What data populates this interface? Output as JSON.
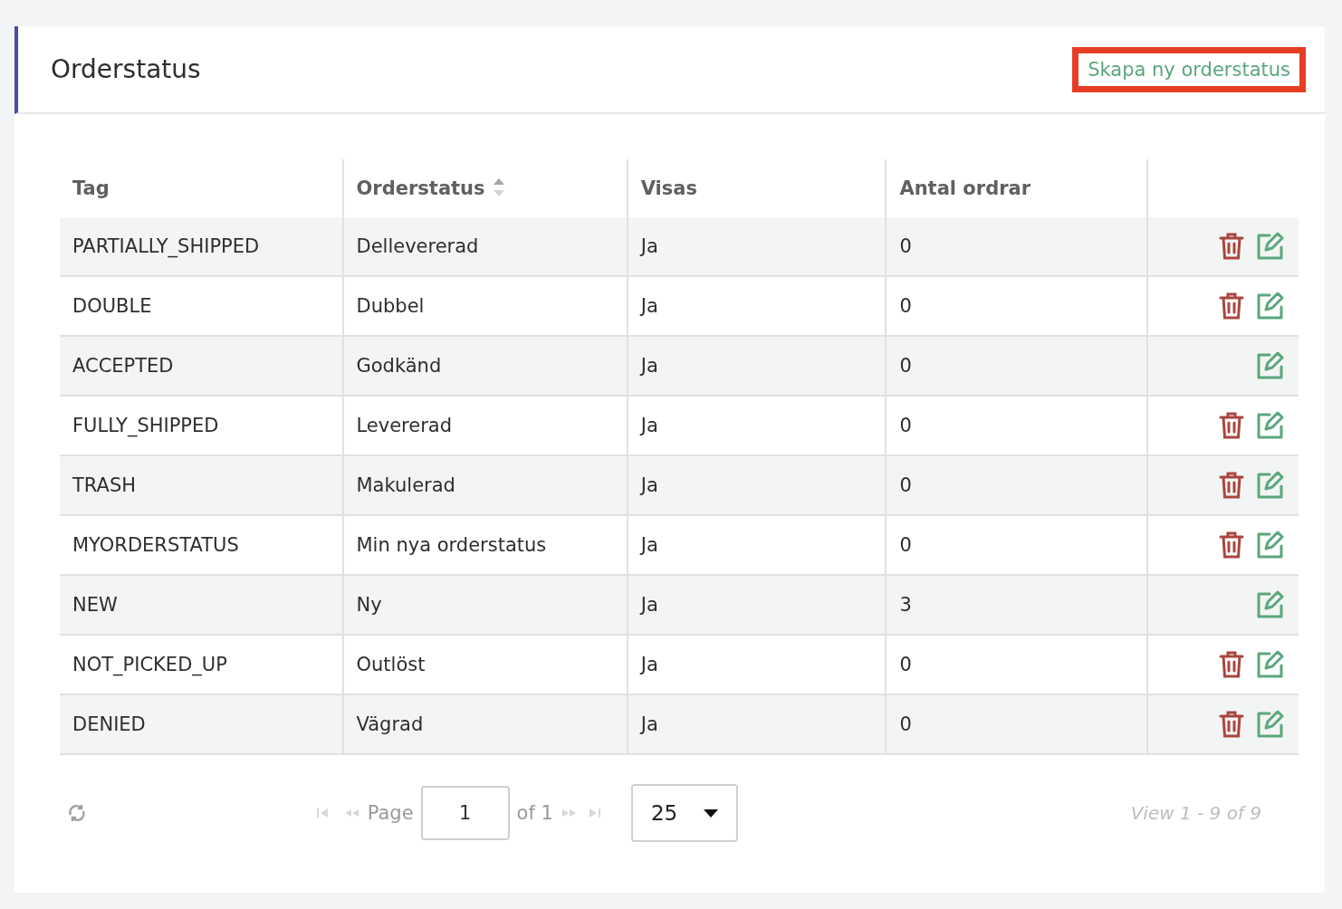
{
  "header": {
    "title": "Orderstatus",
    "create_link": {
      "label": "Skapa ny orderstatus",
      "highlighted": true
    }
  },
  "table": {
    "columns": [
      {
        "label": "Tag",
        "sortable": false
      },
      {
        "label": "Orderstatus",
        "sortable": true
      },
      {
        "label": "Visas",
        "sortable": false
      },
      {
        "label": "Antal ordrar",
        "sortable": false
      }
    ],
    "rows": [
      {
        "tag": "PARTIALLY_SHIPPED",
        "status": "Dellevererad",
        "shown": "Ja",
        "orders": "0",
        "deletable": true
      },
      {
        "tag": "DOUBLE",
        "status": "Dubbel",
        "shown": "Ja",
        "orders": "0",
        "deletable": true
      },
      {
        "tag": "ACCEPTED",
        "status": "Godkänd",
        "shown": "Ja",
        "orders": "0",
        "deletable": false
      },
      {
        "tag": "FULLY_SHIPPED",
        "status": "Levererad",
        "shown": "Ja",
        "orders": "0",
        "deletable": true
      },
      {
        "tag": "TRASH",
        "status": "Makulerad",
        "shown": "Ja",
        "orders": "0",
        "deletable": true
      },
      {
        "tag": "MYORDERSTATUS",
        "status": "Min nya orderstatus",
        "shown": "Ja",
        "orders": "0",
        "deletable": true
      },
      {
        "tag": "NEW",
        "status": "Ny",
        "shown": "Ja",
        "orders": "3",
        "deletable": false
      },
      {
        "tag": "NOT_PICKED_UP",
        "status": "Outlöst",
        "shown": "Ja",
        "orders": "0",
        "deletable": true
      },
      {
        "tag": "DENIED",
        "status": "Vägrad",
        "shown": "Ja",
        "orders": "0",
        "deletable": true
      }
    ]
  },
  "pager": {
    "page_label": "Page",
    "page": "1",
    "of_label": "of 1",
    "page_size": "25",
    "view_info": "View 1 - 9 of 9"
  }
}
